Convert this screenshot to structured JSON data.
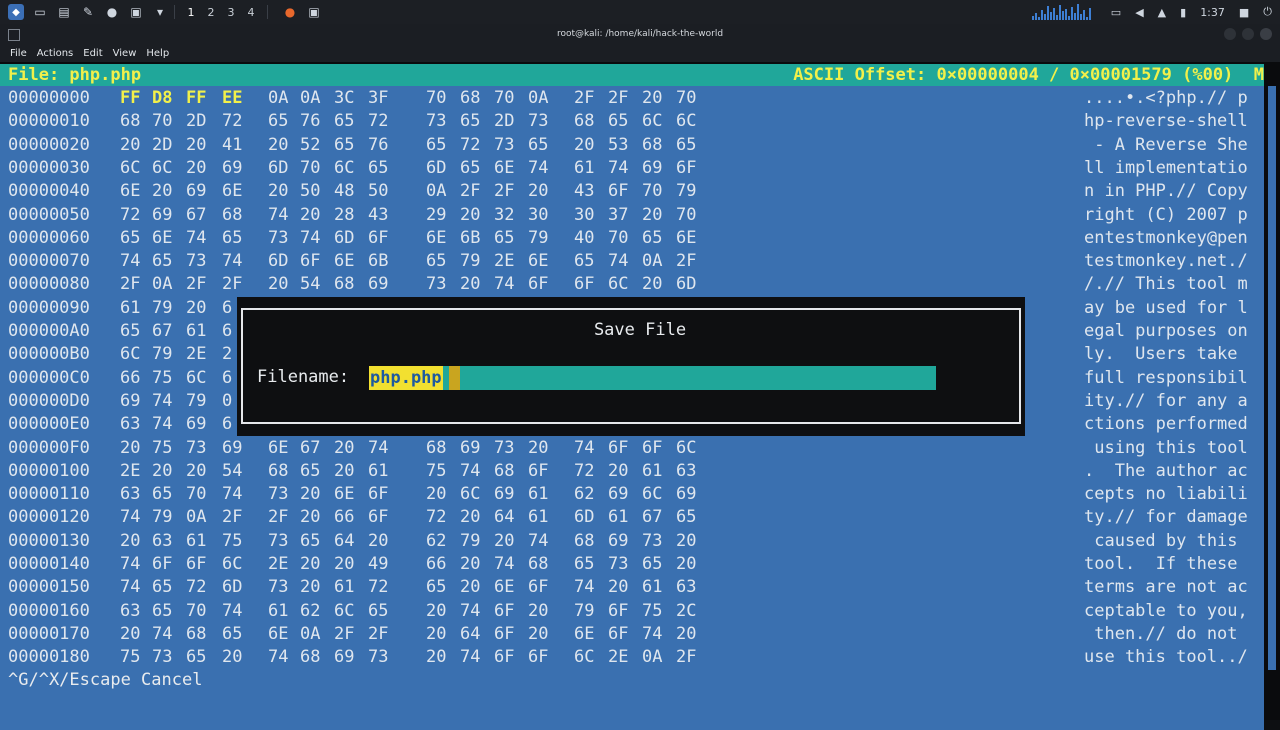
{
  "taskbar": {
    "workspaces": [
      "1",
      "2",
      "3",
      "4"
    ],
    "clock": "1:37"
  },
  "window": {
    "title": "root@kali: /home/kali/hack-the-world"
  },
  "menu": {
    "items": [
      "File",
      "Actions",
      "Edit",
      "View",
      "Help"
    ]
  },
  "hexview": {
    "file_label": "File: php.php",
    "offset_label": "ASCII Offset: 0×00000004 / 0×00001579 (%00)  M",
    "rows": [
      {
        "off": "00000000",
        "bytes": [
          "FF",
          "D8",
          "FF",
          "EE",
          "0A",
          "0A",
          "3C",
          "3F",
          "70",
          "68",
          "70",
          "0A",
          "2F",
          "2F",
          "20",
          "70"
        ],
        "ascii": "....•.<?php.// p"
      },
      {
        "off": "00000010",
        "bytes": [
          "68",
          "70",
          "2D",
          "72",
          "65",
          "76",
          "65",
          "72",
          "73",
          "65",
          "2D",
          "73",
          "68",
          "65",
          "6C",
          "6C"
        ],
        "ascii": "hp-reverse-shell"
      },
      {
        "off": "00000020",
        "bytes": [
          "20",
          "2D",
          "20",
          "41",
          "20",
          "52",
          "65",
          "76",
          "65",
          "72",
          "73",
          "65",
          "20",
          "53",
          "68",
          "65"
        ],
        "ascii": " - A Reverse She"
      },
      {
        "off": "00000030",
        "bytes": [
          "6C",
          "6C",
          "20",
          "69",
          "6D",
          "70",
          "6C",
          "65",
          "6D",
          "65",
          "6E",
          "74",
          "61",
          "74",
          "69",
          "6F"
        ],
        "ascii": "ll implementatio"
      },
      {
        "off": "00000040",
        "bytes": [
          "6E",
          "20",
          "69",
          "6E",
          "20",
          "50",
          "48",
          "50",
          "0A",
          "2F",
          "2F",
          "20",
          "43",
          "6F",
          "70",
          "79"
        ],
        "ascii": "n in PHP.// Copy"
      },
      {
        "off": "00000050",
        "bytes": [
          "72",
          "69",
          "67",
          "68",
          "74",
          "20",
          "28",
          "43",
          "29",
          "20",
          "32",
          "30",
          "30",
          "37",
          "20",
          "70"
        ],
        "ascii": "right (C) 2007 p"
      },
      {
        "off": "00000060",
        "bytes": [
          "65",
          "6E",
          "74",
          "65",
          "73",
          "74",
          "6D",
          "6F",
          "6E",
          "6B",
          "65",
          "79",
          "40",
          "70",
          "65",
          "6E"
        ],
        "ascii": "entestmonkey@pen"
      },
      {
        "off": "00000070",
        "bytes": [
          "74",
          "65",
          "73",
          "74",
          "6D",
          "6F",
          "6E",
          "6B",
          "65",
          "79",
          "2E",
          "6E",
          "65",
          "74",
          "0A",
          "2F"
        ],
        "ascii": "testmonkey.net./"
      },
      {
        "off": "00000080",
        "bytes": [
          "2F",
          "0A",
          "2F",
          "2F",
          "20",
          "54",
          "68",
          "69",
          "73",
          "20",
          "74",
          "6F",
          "6F",
          "6C",
          "20",
          "6D"
        ],
        "ascii": "/.// This tool m"
      },
      {
        "off": "00000090",
        "bytes": [
          "61",
          "79",
          "20",
          "6",
          "",
          "",
          "",
          "",
          "",
          "",
          "",
          "",
          "",
          "",
          "",
          ""
        ],
        "ascii": "ay be used for l"
      },
      {
        "off": "000000A0",
        "bytes": [
          "65",
          "67",
          "61",
          "6",
          "",
          "",
          "",
          "",
          "",
          "",
          "",
          "",
          "",
          "",
          "",
          ""
        ],
        "ascii": "egal purposes on"
      },
      {
        "off": "000000B0",
        "bytes": [
          "6C",
          "79",
          "2E",
          "2",
          "",
          "",
          "",
          "",
          "",
          "",
          "",
          "",
          "",
          "",
          "",
          ""
        ],
        "ascii": "ly.  Users take "
      },
      {
        "off": "000000C0",
        "bytes": [
          "66",
          "75",
          "6C",
          "6",
          "",
          "",
          "",
          "",
          "",
          "",
          "",
          "",
          "",
          "",
          "",
          ""
        ],
        "ascii": "full responsibil"
      },
      {
        "off": "000000D0",
        "bytes": [
          "69",
          "74",
          "79",
          "0",
          "",
          "",
          "",
          "",
          "",
          "",
          "",
          "",
          "",
          "",
          "",
          ""
        ],
        "ascii": "ity.// for any a"
      },
      {
        "off": "000000E0",
        "bytes": [
          "63",
          "74",
          "69",
          "6",
          "",
          "",
          "",
          "",
          "",
          "",
          "",
          "",
          "",
          "",
          "",
          ""
        ],
        "ascii": "ctions performed"
      },
      {
        "off": "000000F0",
        "bytes": [
          "20",
          "75",
          "73",
          "69",
          "6E",
          "67",
          "20",
          "74",
          "68",
          "69",
          "73",
          "20",
          "74",
          "6F",
          "6F",
          "6C"
        ],
        "ascii": " using this tool"
      },
      {
        "off": "00000100",
        "bytes": [
          "2E",
          "20",
          "20",
          "54",
          "68",
          "65",
          "20",
          "61",
          "75",
          "74",
          "68",
          "6F",
          "72",
          "20",
          "61",
          "63"
        ],
        "ascii": ".  The author ac"
      },
      {
        "off": "00000110",
        "bytes": [
          "63",
          "65",
          "70",
          "74",
          "73",
          "20",
          "6E",
          "6F",
          "20",
          "6C",
          "69",
          "61",
          "62",
          "69",
          "6C",
          "69"
        ],
        "ascii": "cepts no liabili"
      },
      {
        "off": "00000120",
        "bytes": [
          "74",
          "79",
          "0A",
          "2F",
          "2F",
          "20",
          "66",
          "6F",
          "72",
          "20",
          "64",
          "61",
          "6D",
          "61",
          "67",
          "65"
        ],
        "ascii": "ty.// for damage"
      },
      {
        "off": "00000130",
        "bytes": [
          "20",
          "63",
          "61",
          "75",
          "73",
          "65",
          "64",
          "20",
          "62",
          "79",
          "20",
          "74",
          "68",
          "69",
          "73",
          "20"
        ],
        "ascii": " caused by this "
      },
      {
        "off": "00000140",
        "bytes": [
          "74",
          "6F",
          "6F",
          "6C",
          "2E",
          "20",
          "20",
          "49",
          "66",
          "20",
          "74",
          "68",
          "65",
          "73",
          "65",
          "20"
        ],
        "ascii": "tool.  If these "
      },
      {
        "off": "00000150",
        "bytes": [
          "74",
          "65",
          "72",
          "6D",
          "73",
          "20",
          "61",
          "72",
          "65",
          "20",
          "6E",
          "6F",
          "74",
          "20",
          "61",
          "63"
        ],
        "ascii": "terms are not ac"
      },
      {
        "off": "00000160",
        "bytes": [
          "63",
          "65",
          "70",
          "74",
          "61",
          "62",
          "6C",
          "65",
          "20",
          "74",
          "6F",
          "20",
          "79",
          "6F",
          "75",
          "2C"
        ],
        "ascii": "ceptable to you,"
      },
      {
        "off": "00000170",
        "bytes": [
          "20",
          "74",
          "68",
          "65",
          "6E",
          "0A",
          "2F",
          "2F",
          "20",
          "64",
          "6F",
          "20",
          "6E",
          "6F",
          "74",
          "20"
        ],
        "ascii": " then.// do not "
      },
      {
        "off": "00000180",
        "bytes": [
          "75",
          "73",
          "65",
          "20",
          "74",
          "68",
          "69",
          "73",
          "20",
          "74",
          "6F",
          "6F",
          "6C",
          "2E",
          "0A",
          "2F"
        ],
        "ascii": "use this tool../"
      }
    ]
  },
  "dialog": {
    "title": "Save File",
    "label": "Filename:",
    "value": "php.php"
  },
  "footer": {
    "hint": "^G/^X/Escape Cancel"
  }
}
